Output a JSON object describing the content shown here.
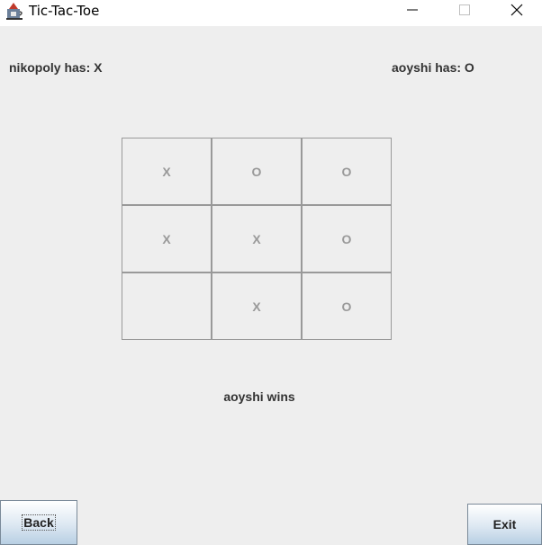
{
  "window": {
    "title": "Tic-Tac-Toe"
  },
  "players": {
    "player1": "nikopoly has: X",
    "player2": "aoyshi has: O"
  },
  "board": {
    "cells": [
      "X",
      "O",
      "O",
      "X",
      "X",
      "O",
      "",
      "X",
      "O"
    ]
  },
  "status": "aoyshi wins",
  "buttons": {
    "back": "Back",
    "exit": "Exit"
  },
  "icons": {
    "app": "java-cup-icon",
    "minimize": "minimize-icon",
    "maximize": "maximize-icon",
    "close": "close-icon"
  },
  "colors": {
    "background": "#eeeeee",
    "mark": "#999999",
    "text": "#333333"
  }
}
